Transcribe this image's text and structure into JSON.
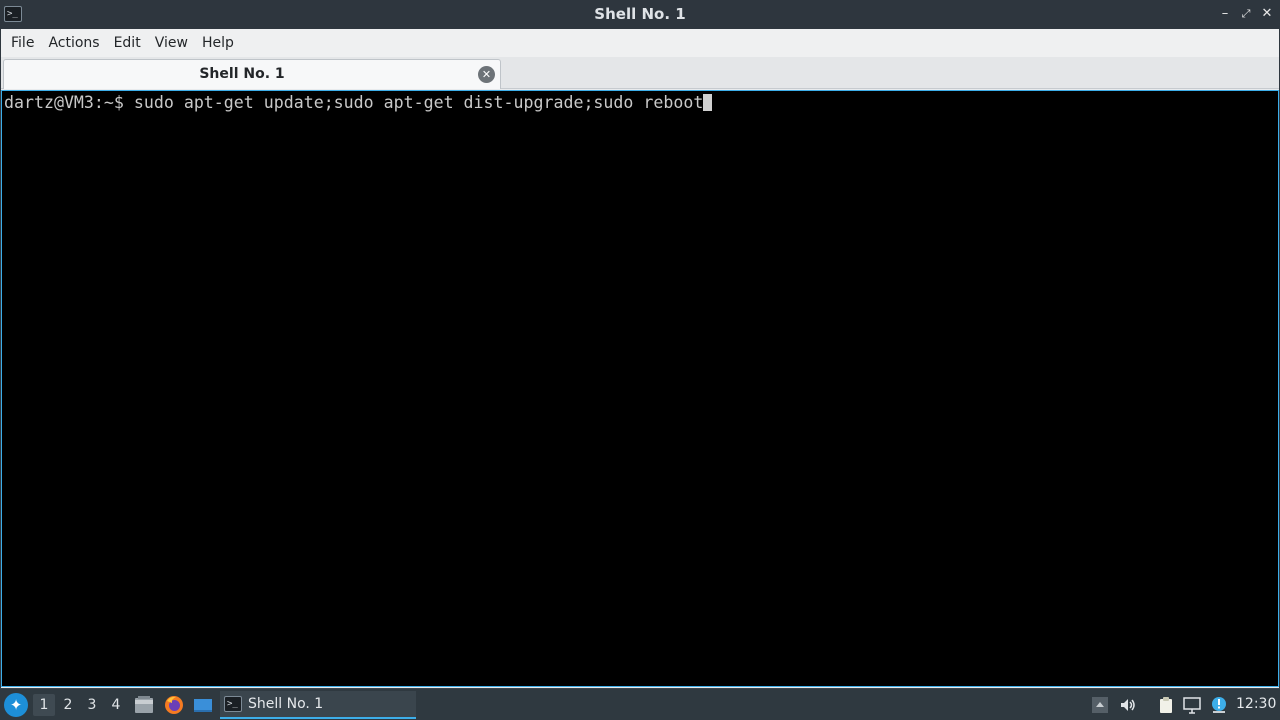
{
  "window": {
    "title": "Shell No. 1",
    "app_icon": "terminal-icon",
    "controls": [
      "minimize-icon",
      "maximize-icon",
      "close-icon"
    ]
  },
  "menubar": {
    "items": [
      "File",
      "Actions",
      "Edit",
      "View",
      "Help"
    ]
  },
  "tabs": [
    {
      "label": "Shell No. 1",
      "close_icon": "close-circle-icon",
      "active": true
    }
  ],
  "terminal": {
    "prompt": "dartz@VM3:~$ ",
    "command": "sudo apt-get update;sudo apt-get dist-upgrade;sudo reboot",
    "background": "#000000",
    "foreground": "#c8c8c8"
  },
  "taskbar": {
    "start_icon": "lxqt-start-icon",
    "desktops": [
      "1",
      "2",
      "3",
      "4"
    ],
    "active_desktop": "1",
    "quick_launch": [
      "file-manager-icon",
      "firefox-icon",
      "desktop-icon"
    ],
    "task": {
      "label": "Shell No. 1",
      "icon": "terminal-icon"
    },
    "tray": [
      "tray-up-icon",
      "volume-icon",
      "clipboard-icon",
      "monitor-icon",
      "update-notifier-icon"
    ],
    "clock": "12:30",
    "accent": "#3daee9"
  }
}
